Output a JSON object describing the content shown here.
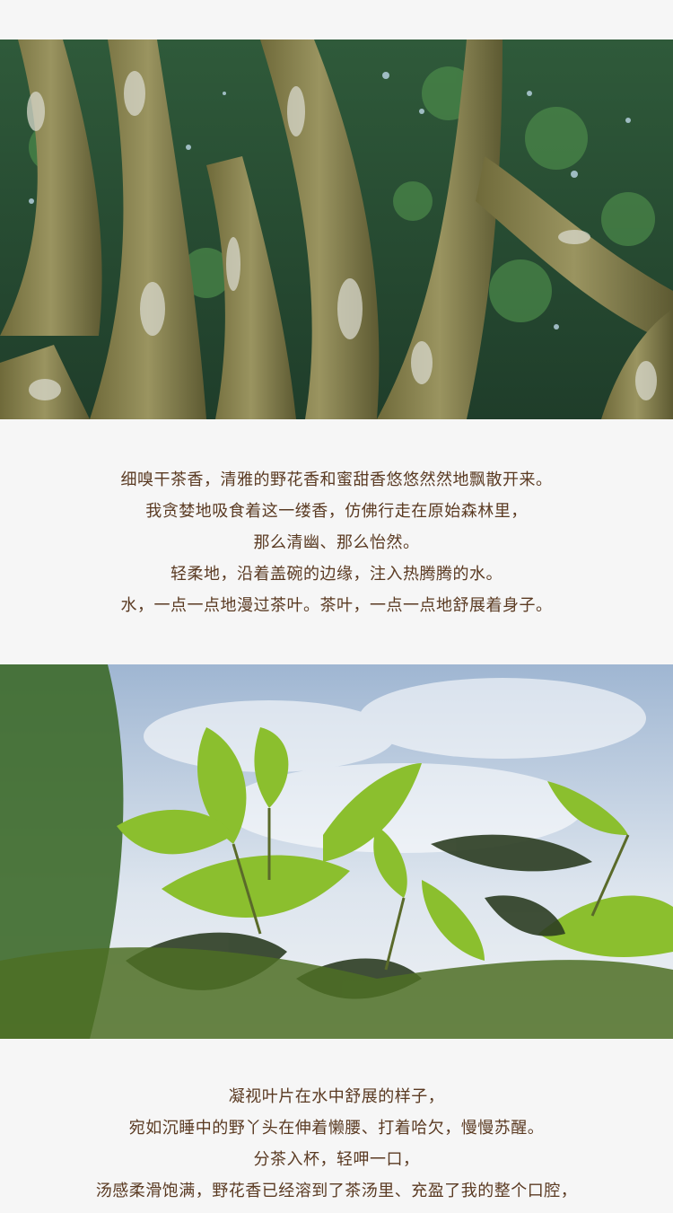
{
  "paragraph_1": {
    "lines": [
      "细嗅干茶香，清雅的野花香和蜜甜香悠悠然然地飘散开来。",
      "我贪婪地吸食着这一缕香，仿佛行走在原始森林里，",
      "那么清幽、那么怡然。",
      "轻柔地，沿着盖碗的边缘，注入热腾腾的水。",
      "水，一点一点地漫过茶叶。茶叶，一点一点地舒展着身子。"
    ]
  },
  "paragraph_2": {
    "lines": [
      "凝视叶片在水中舒展的样子，",
      "宛如沉睡中的野丫头在伸着懒腰、打着哈欠，慢慢苏醒。",
      "分茶入杯，轻呷一口，",
      "汤感柔滑饱满，野花香已经溶到了茶汤里、充盈了我的整个口腔，"
    ]
  },
  "colors": {
    "background": "#f6f6f6",
    "text": "#5a3a22"
  }
}
